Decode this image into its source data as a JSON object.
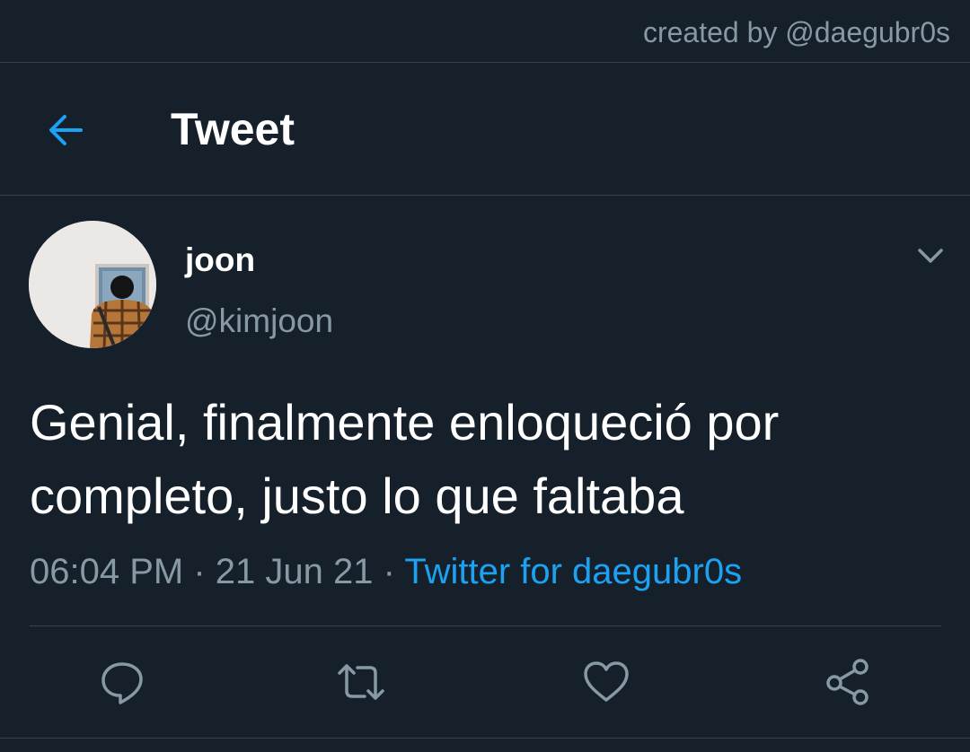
{
  "credit": "created by @daegubr0s",
  "header": {
    "title": "Tweet",
    "back_icon": "back-arrow-icon"
  },
  "tweet": {
    "display_name": "joon",
    "handle": "@kimjoon",
    "text": "Genial, finalmente enloqueció por completo, justo lo que faltaba",
    "time": "06:04 PM",
    "separator": "·",
    "date": "21 Jun 21",
    "source": "Twitter for daegubr0s"
  },
  "actions": [
    {
      "name": "reply",
      "icon": "reply-icon"
    },
    {
      "name": "retweet",
      "icon": "retweet-icon"
    },
    {
      "name": "like",
      "icon": "heart-icon"
    },
    {
      "name": "share",
      "icon": "share-icon"
    }
  ],
  "colors": {
    "background": "#15202b",
    "border": "#38444d",
    "secondary_text": "#8899a6",
    "accent": "#1da1f2"
  }
}
